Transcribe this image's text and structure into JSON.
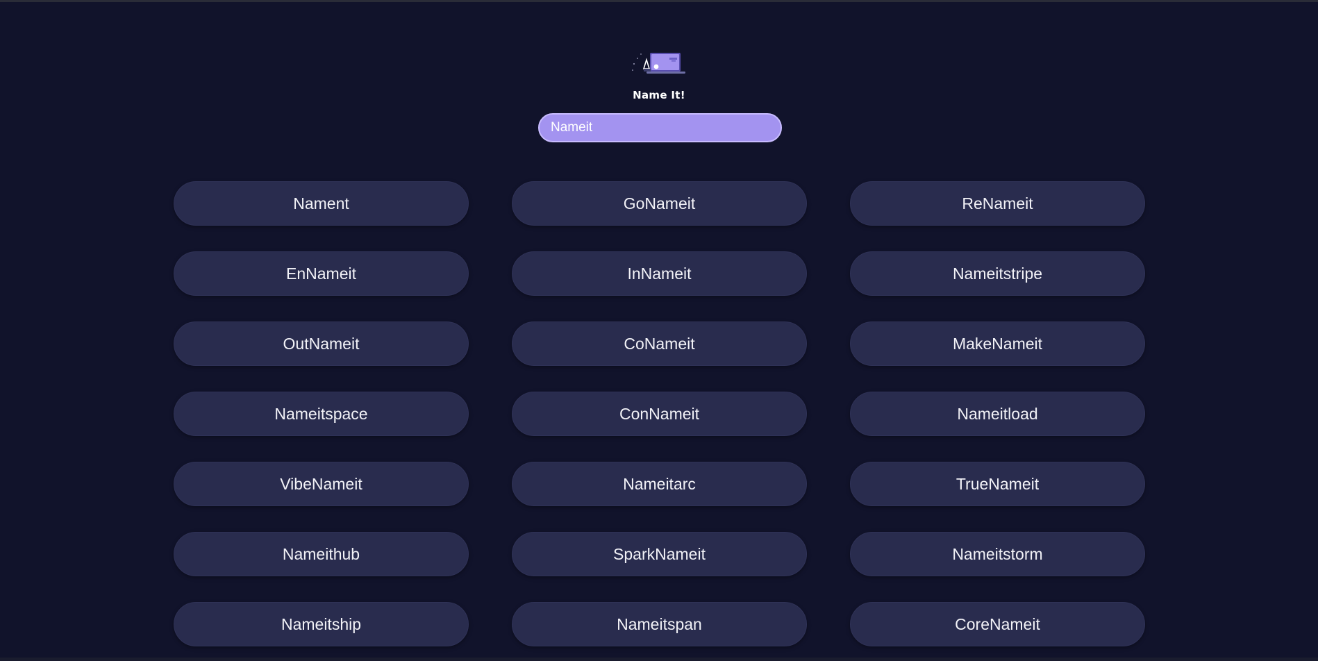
{
  "app": {
    "title": "Name It!",
    "logo_icon": "laptop-logo-icon"
  },
  "search": {
    "value": "Nameit",
    "placeholder": ""
  },
  "colors": {
    "background": "#11132b",
    "card": "#292c4e",
    "input": "#a393f0",
    "input_border": "#c8bcff",
    "text": "#f2f2f7"
  },
  "suggestions": [
    "Nament",
    "GoNameit",
    "ReNameit",
    "EnNameit",
    "InNameit",
    "Nameitstripe",
    "OutNameit",
    "CoNameit",
    "MakeNameit",
    "Nameitspace",
    "ConNameit",
    "Nameitload",
    "VibeNameit",
    "Nameitarc",
    "TrueNameit",
    "Nameithub",
    "SparkNameit",
    "Nameitstorm",
    "Nameitship",
    "Nameitspan",
    "CoreNameit"
  ]
}
